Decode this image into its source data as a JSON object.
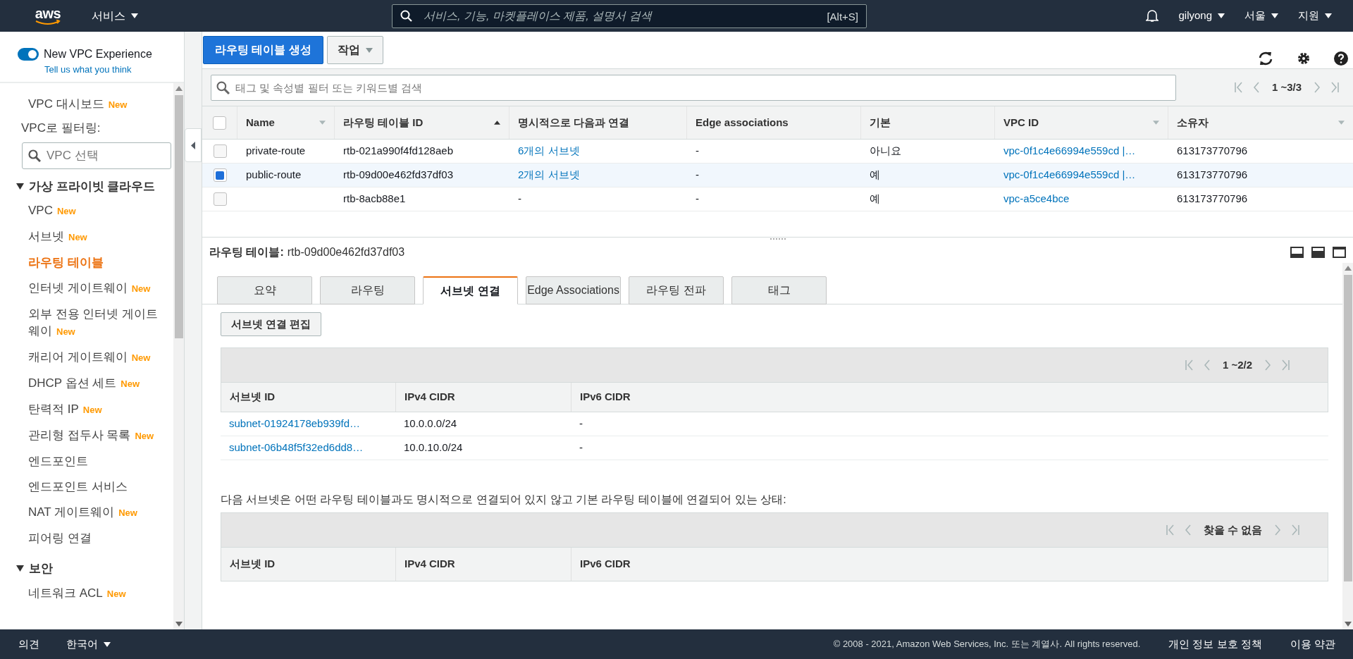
{
  "top_bar": {
    "logo": "aws",
    "services": "서비스",
    "search_placeholder": "서비스, 기능, 마켓플레이스 제품, 설명서 검색",
    "shortcut": "[Alt+S]",
    "user": "gilyong",
    "region": "서울",
    "support": "지원"
  },
  "sidebar": {
    "experience_toggle": {
      "label": "New VPC Experience",
      "on": true
    },
    "feedback_link": "Tell us what you think",
    "top_items": [
      {
        "label": "VPC 대시보드",
        "badge": "New",
        "selected": false
      }
    ],
    "filter_label": "VPC로 필터링:",
    "vpc_search_placeholder": "VPC 선택",
    "sections": [
      {
        "title": "가상 프라이빗 클라우드",
        "expanded": true,
        "items": [
          {
            "label": "VPC",
            "badge": "New",
            "selected": false
          },
          {
            "label": "서브넷",
            "badge": "New",
            "selected": false
          },
          {
            "label": "라우팅 테이블",
            "selected": true
          },
          {
            "label": "인터넷 게이트웨이",
            "badge": "New",
            "selected": false
          },
          {
            "label": "외부 전용 인터넷 게이트웨이",
            "badge": "New",
            "selected": false
          },
          {
            "label": "캐리어 게이트웨이",
            "badge": "New",
            "selected": false
          },
          {
            "label": "DHCP 옵션 세트",
            "badge": "New",
            "selected": false
          },
          {
            "label": "탄력적 IP",
            "badge": "New",
            "selected": false
          },
          {
            "label": "관리형 접두사 목록",
            "badge": "New",
            "selected": false
          },
          {
            "label": "엔드포인트",
            "selected": false
          },
          {
            "label": "엔드포인트 서비스",
            "selected": false
          },
          {
            "label": "NAT 게이트웨이",
            "badge": "New",
            "selected": false
          },
          {
            "label": "피어링 연결",
            "selected": false
          }
        ]
      },
      {
        "title": "보안",
        "expanded": true,
        "items": [
          {
            "label": "네트워크 ACL",
            "badge": "New",
            "selected": false
          }
        ]
      }
    ]
  },
  "toolbar": {
    "create_button": "라우팅 테이블 생성",
    "actions_button": "작업"
  },
  "filter": {
    "placeholder": "태그 및 속성별 필터 또는 키워드별 검색",
    "pagination": "1 ~3/3"
  },
  "table": {
    "columns": [
      {
        "label": "Name",
        "kind": "menu"
      },
      {
        "label": "라우팅 테이블 ID",
        "kind": "sorted"
      },
      {
        "label": "명시적으로 다음과 연결",
        "kind": "plain"
      },
      {
        "label": "Edge associations",
        "kind": "plain"
      },
      {
        "label": "기본",
        "kind": "plain"
      },
      {
        "label": "VPC ID",
        "kind": "menu"
      },
      {
        "label": "소유자",
        "kind": "menu"
      }
    ],
    "all_selected": false,
    "rows": [
      {
        "selected": false,
        "cells": [
          {
            "text": "private-route",
            "link": false
          },
          {
            "text": "rtb-021a990f4fd128aeb",
            "link": false
          },
          {
            "text": "6개의 서브넷",
            "link": true
          },
          {
            "text": "-",
            "link": false
          },
          {
            "text": "아니요",
            "link": false
          },
          {
            "text": "vpc-0f1c4e66994e559cd |…",
            "link": true
          },
          {
            "text": "613173770796",
            "link": false
          }
        ]
      },
      {
        "selected": true,
        "cells": [
          {
            "text": "public-route",
            "link": false
          },
          {
            "text": "rtb-09d00e462fd37df03",
            "link": false
          },
          {
            "text": "2개의 서브넷",
            "link": true
          },
          {
            "text": "-",
            "link": false
          },
          {
            "text": "예",
            "link": false
          },
          {
            "text": "vpc-0f1c4e66994e559cd |…",
            "link": true
          },
          {
            "text": "613173770796",
            "link": false
          }
        ]
      },
      {
        "selected": false,
        "cells": [
          null,
          {
            "text": "rtb-8acb88e1",
            "link": false
          },
          {
            "text": "-",
            "link": false
          },
          {
            "text": "-",
            "link": false
          },
          {
            "text": "예",
            "link": false
          },
          {
            "text": "vpc-a5ce4bce",
            "link": true
          },
          {
            "text": "613173770796",
            "link": false
          }
        ]
      }
    ]
  },
  "detail": {
    "title_label": "라우팅 테이블:",
    "title_value": "rtb-09d00e462fd37df03",
    "tabs": [
      {
        "label": "요약",
        "selected": false
      },
      {
        "label": "라우팅",
        "selected": false
      },
      {
        "label": "서브넷 연결",
        "selected": true
      },
      {
        "label": "Edge Associations",
        "selected": false
      },
      {
        "label": "라우팅 전파",
        "selected": false
      },
      {
        "label": "태그",
        "selected": false
      }
    ],
    "edit_button": "서브넷 연결 편집",
    "associated": {
      "pagination": "1 ~2/2",
      "columns": [
        "서브넷 ID",
        "IPv4 CIDR",
        "IPv6 CIDR"
      ],
      "rows": [
        [
          "subnet-01924178eb939fd…",
          "10.0.0.0/24",
          "-"
        ],
        [
          "subnet-06b48f5f32ed6dd8…",
          "10.0.10.0/24",
          "-"
        ]
      ]
    },
    "note": "다음 서브넷은 어떤 라우팅 테이블과도 명시적으로 연결되어 있지 않고 기본 라우팅 테이블에 연결되어 있는 상태:",
    "unassociated": {
      "pagination": "찾을 수 없음",
      "columns": [
        "서브넷 ID",
        "IPv4 CIDR",
        "IPv6 CIDR"
      ]
    }
  },
  "footer": {
    "feedback": "의견",
    "language": "한국어",
    "copyright": "© 2008 - 2021, Amazon Web Services, Inc. 또는 계열사. All rights reserved.",
    "privacy": "개인 정보 보호 정책",
    "terms": "이용 약관"
  }
}
